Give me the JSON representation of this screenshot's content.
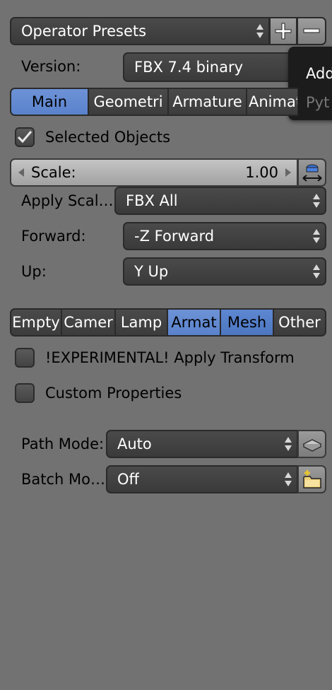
{
  "presets": {
    "label": "Operator Presets",
    "add_icon": "plus-icon",
    "remove_icon": "minus-icon"
  },
  "version": {
    "label": "Version:",
    "value": "FBX 7.4 binary"
  },
  "tooltip": {
    "line1": "Add",
    "line2": "Pyt"
  },
  "main_tabs": [
    {
      "label": "Main",
      "active": true
    },
    {
      "label": "Geometri",
      "active": false
    },
    {
      "label": "Armature",
      "active": false
    },
    {
      "label": "Animati",
      "active": false
    }
  ],
  "selected_objects": {
    "label": "Selected Objects",
    "checked": true
  },
  "scale": {
    "label": "Scale:",
    "value": "1.00",
    "icon": "scale-apply-icon"
  },
  "apply_scalings": {
    "label": "Apply Scal…",
    "value": "FBX All"
  },
  "forward": {
    "label": "Forward:",
    "value": "-Z Forward"
  },
  "up": {
    "label": "Up:",
    "value": "Y Up"
  },
  "object_types": [
    {
      "label": "Empty",
      "active": false
    },
    {
      "label": "Camer",
      "active": false
    },
    {
      "label": "Lamp",
      "active": false
    },
    {
      "label": "Armat",
      "active": true
    },
    {
      "label": "Mesh",
      "active": true
    },
    {
      "label": "Other",
      "active": false
    }
  ],
  "apply_transform": {
    "label": "!EXPERIMENTAL! Apply Transform",
    "checked": false
  },
  "custom_properties": {
    "label": "Custom Properties",
    "checked": false
  },
  "path_mode": {
    "label": "Path Mode:",
    "value": "Auto",
    "icon": "embed-textures-icon"
  },
  "batch_mode": {
    "label": "Batch Mo…",
    "value": "Off",
    "icon": "new-folder-icon"
  }
}
